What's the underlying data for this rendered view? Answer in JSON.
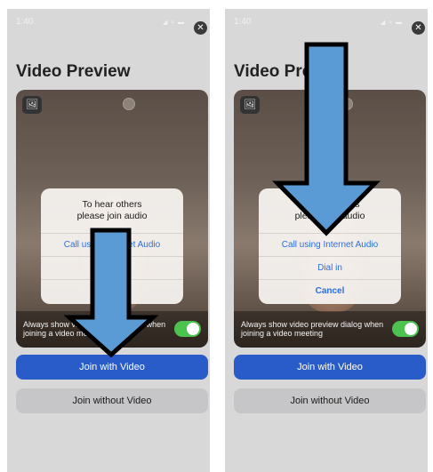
{
  "status_bar": {
    "time": "1:40",
    "icons": "◢ ≈ ▬",
    "close_glyph": "✕"
  },
  "screens": [
    {
      "title": "Video Preview",
      "dialog": {
        "title_line1": "To hear others",
        "title_line2": "please join audio",
        "options": [
          "Call using Internet Audio",
          "",
          ""
        ]
      },
      "toggle_label": "Always show video preview dialog when joining a video meeting",
      "join_with_video": "Join with Video",
      "join_without_video": "Join without Video"
    },
    {
      "title": "Video Preview",
      "dialog": {
        "title_line1": "To hear others",
        "title_line2": "please join audio",
        "options": [
          "Call using Internet Audio",
          "Dial in",
          "Cancel"
        ]
      },
      "toggle_label": "Always show video preview dialog when joining a video meeting",
      "join_with_video": "Join with Video",
      "join_without_video": "Join without Video"
    }
  ],
  "icons": {
    "photo": "🖼",
    "arrow": "down-arrow"
  },
  "colors": {
    "accent_blue": "#2a5cc9",
    "toggle_green": "#4cc24f",
    "arrow_fill": "#5b9bd5",
    "arrow_stroke": "#000000"
  }
}
